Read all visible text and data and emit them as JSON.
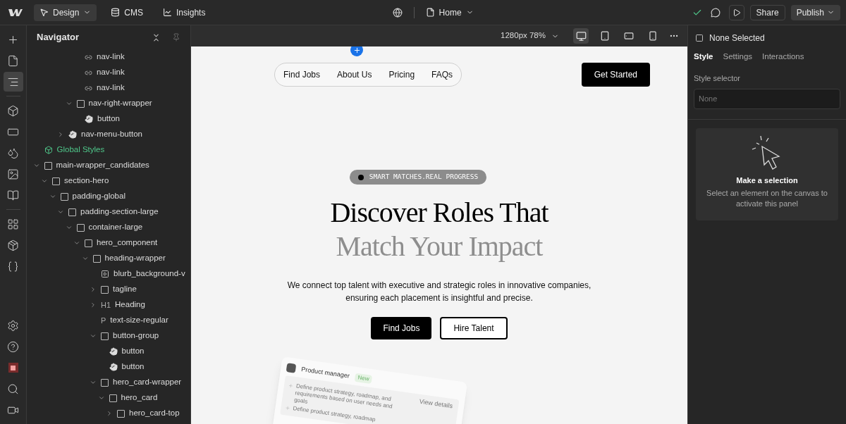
{
  "topbar": {
    "modes": [
      {
        "label": "Design",
        "selected": true,
        "dropdown": true
      },
      {
        "label": "CMS",
        "selected": false,
        "dropdown": false
      },
      {
        "label": "Insights",
        "selected": false,
        "dropdown": false
      }
    ],
    "page": "Home",
    "share": "Share",
    "publish": "Publish"
  },
  "rail": [
    {
      "selected": false
    },
    {
      "selected": false
    },
    {
      "selected": true
    },
    {
      "selected": false
    },
    {
      "selected": false
    },
    {
      "selected": false
    },
    {
      "selected": false
    },
    {
      "selected": false
    },
    {
      "selected": false
    },
    {
      "selected": false
    },
    {
      "selected": false
    },
    {
      "selected": false
    },
    {
      "selected": false
    },
    {
      "selected": false
    },
    {
      "selected": false
    },
    {
      "selected": false
    }
  ],
  "navigator": {
    "title": "Navigator",
    "tree": [
      {
        "children": [
          {
            "children": [
              {
                "children": [
                  {
                    "children": [
                      {
                        "children": [
                          {
                            "label": "nav-link",
                            "kind": "link"
                          },
                          {
                            "label": "nav-link",
                            "kind": "link"
                          },
                          {
                            "label": "nav-link",
                            "kind": "link"
                          }
                        ]
                      },
                      {
                        "label": "nav-right-wrapper",
                        "kind": "box",
                        "expanded": true,
                        "children": [
                          {
                            "label": "button",
                            "kind": "button"
                          }
                        ]
                      }
                    ]
                  },
                  {
                    "label": "nav-menu-button",
                    "kind": "button",
                    "expanded": false
                  }
                ]
              }
            ]
          }
        ]
      },
      {
        "label": "Global Styles",
        "kind": "global"
      },
      {
        "label": "main-wrapper_candidates",
        "kind": "box",
        "expanded": true,
        "children": [
          {
            "label": "section-hero",
            "kind": "box",
            "expanded": true,
            "children": [
              {
                "label": "padding-global",
                "kind": "box",
                "expanded": true,
                "children": [
                  {
                    "label": "padding-section-large",
                    "kind": "box",
                    "expanded": true,
                    "children": [
                      {
                        "label": "container-large",
                        "kind": "box",
                        "expanded": true,
                        "children": [
                          {
                            "label": "hero_component",
                            "kind": "box",
                            "expanded": true,
                            "children": [
                              {
                                "label": "heading-wrapper",
                                "kind": "box",
                                "expanded": true,
                                "children": [
                                  {
                                    "label": "blurb_background-v",
                                    "kind": "video"
                                  },
                                  {
                                    "label": "tagline",
                                    "kind": "box",
                                    "expanded": false
                                  },
                                  {
                                    "label": "Heading",
                                    "kind": "tag",
                                    "tag": "H1",
                                    "expanded": false
                                  },
                                  {
                                    "label": "text-size-regular",
                                    "kind": "tag",
                                    "tag": "P"
                                  },
                                  {
                                    "label": "button-group",
                                    "kind": "box",
                                    "expanded": true,
                                    "children": [
                                      {
                                        "label": "button",
                                        "kind": "button"
                                      },
                                      {
                                        "label": "button",
                                        "kind": "button"
                                      }
                                    ]
                                  },
                                  {
                                    "label": "hero_card-wrapper",
                                    "kind": "box",
                                    "expanded": true,
                                    "children": [
                                      {
                                        "label": "hero_card",
                                        "kind": "box",
                                        "expanded": true,
                                        "children": [
                                          {
                                            "label": "hero_card-top",
                                            "kind": "box",
                                            "expanded": false
                                          }
                                        ]
                                      }
                                    ]
                                  }
                                ]
                              }
                            ]
                          }
                        ]
                      }
                    ]
                  }
                ]
              }
            ]
          }
        ]
      }
    ]
  },
  "canvas": {
    "size": "1280px 78%",
    "devices": [
      {
        "kind": "desktop",
        "selected": true
      },
      {
        "kind": "tablet",
        "selected": false
      },
      {
        "kind": "landscape",
        "selected": false
      },
      {
        "kind": "phone",
        "selected": false
      }
    ],
    "nav_links": [
      "Find Jobs",
      "About Us",
      "Pricing",
      "FAQs"
    ],
    "cta": "Get Started",
    "tagline": "SMART MATCHES.REAL PROGRESS",
    "heading_lines": [
      "Discover Roles That",
      "Match Your Impact"
    ],
    "paragraph": "We connect top talent with executive and strategic roles in innovative companies, ensuring each placement is insightful and precise.",
    "buttons": [
      {
        "label": "Find Jobs",
        "kind": "primary"
      },
      {
        "label": "Hire Talent",
        "kind": "secondary"
      }
    ],
    "card": {
      "title": "Product manager",
      "badge": "New",
      "link": "View details",
      "bullets": [
        "Define product strategy, roadmap, and requirements based on user needs and goals",
        "Define product strategy, roadmap"
      ]
    }
  },
  "panel": {
    "selection": "None Selected",
    "tabs": [
      {
        "label": "Style",
        "selected": true
      },
      {
        "label": "Settings",
        "selected": false
      },
      {
        "label": "Interactions",
        "selected": false
      }
    ],
    "selector_label": "Style selector",
    "selector_placeholder": "None",
    "empty_title": "Make a selection",
    "empty_text": "Select an element on the canvas to activate this panel"
  }
}
